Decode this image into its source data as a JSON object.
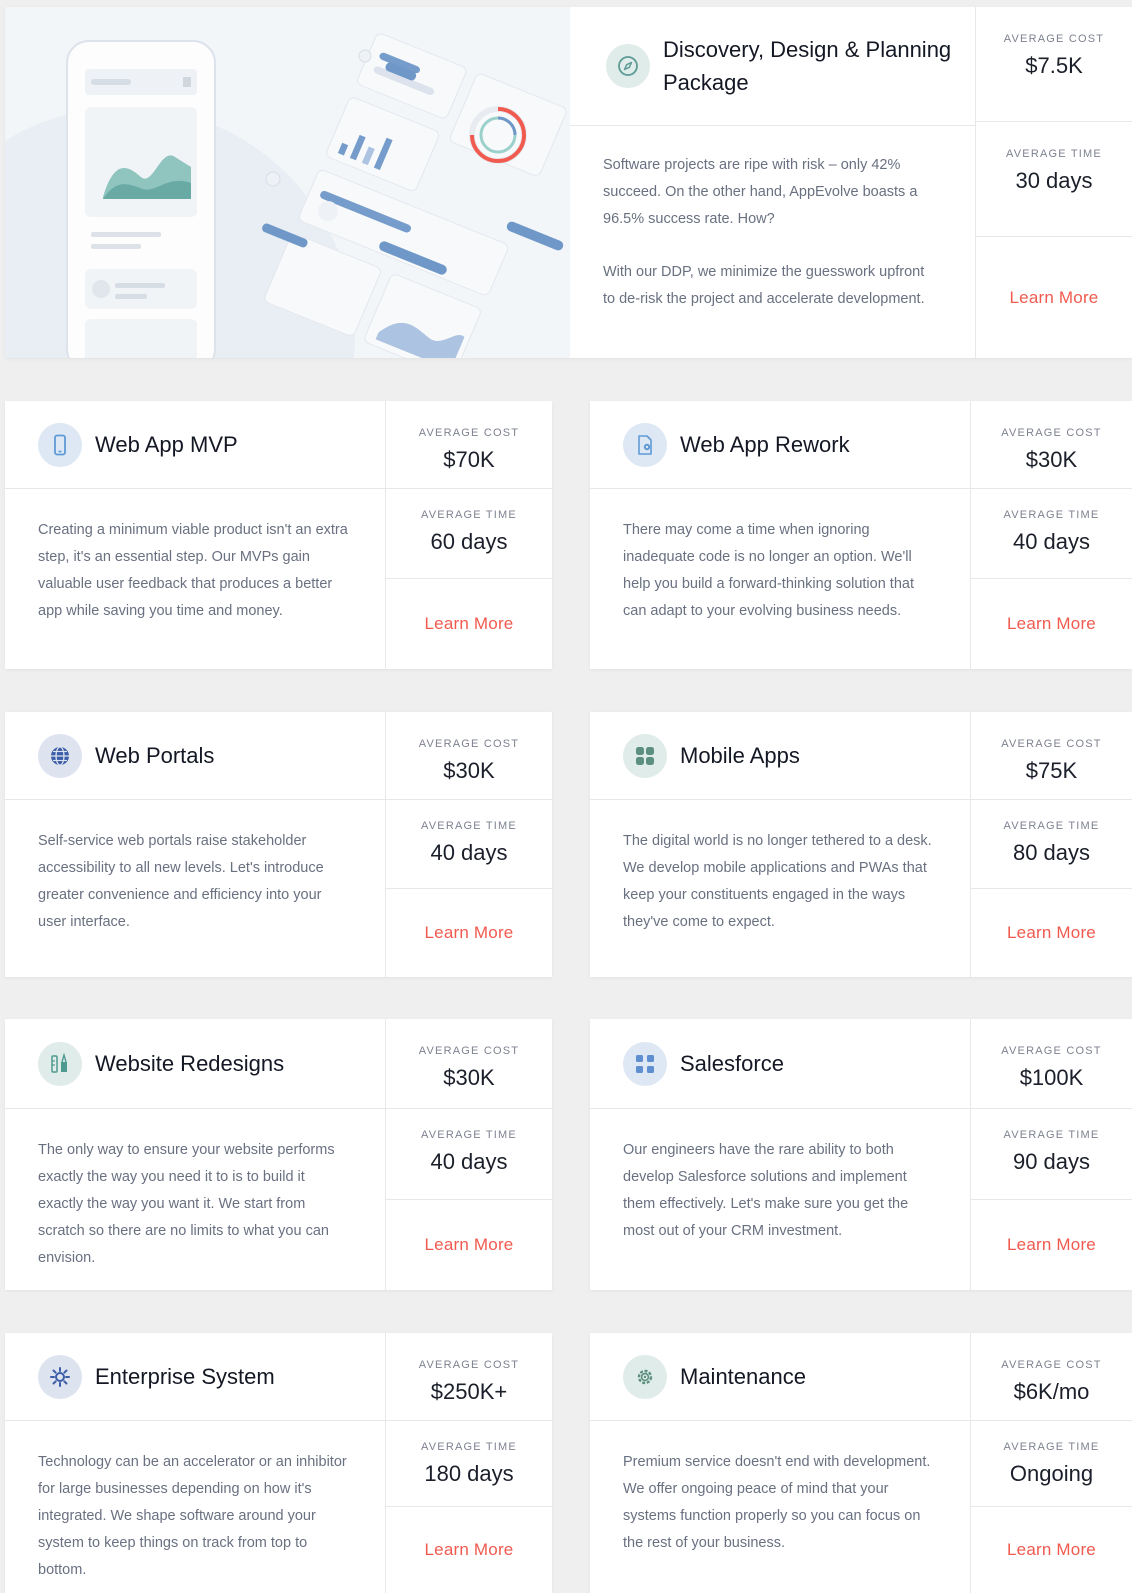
{
  "labels": {
    "cost": "AVERAGE COST",
    "time": "AVERAGE TIME",
    "cta": "Learn More"
  },
  "colors": {
    "accent": "#f05a4f",
    "teal": "#7fbcb7",
    "blue": "#6f98c8"
  },
  "hero": {
    "title": "Discovery, Design & Planning Package",
    "icon": "compass-icon",
    "paragraphs": [
      "Software projects are ripe with risk – only 42% succeed. On the other hand, AppEvolve boasts a 96.5% success rate. How?",
      "With our DDP, we minimize the guesswork upfront to de-risk the project and accelerate development."
    ],
    "cost": "$7.5K",
    "time": "30 days"
  },
  "services": [
    {
      "title": "Web App MVP",
      "icon": "mobile-phone-icon",
      "description": "Creating a minimum viable product isn't an extra step, it's an essential step. Our MVPs gain valuable user feedback that produces a better app while saving you time and money.",
      "cost": "$70K",
      "time": "60 days"
    },
    {
      "title": "Web App Rework",
      "icon": "gear-document-icon",
      "description": "There may come a time when ignoring inadequate code is no longer an option. We'll help you build a forward-thinking solution that can adapt to your evolving business needs.",
      "cost": "$30K",
      "time": "40 days"
    },
    {
      "title": "Web Portals",
      "icon": "globe-icon",
      "description": "Self-service web portals raise stakeholder accessibility to all new levels. Let's introduce greater convenience and efficiency into your user interface.",
      "cost": "$30K",
      "time": "40 days"
    },
    {
      "title": "Mobile Apps",
      "icon": "app-grid-icon",
      "description": "The digital world is no longer tethered to a desk. We develop mobile applications and PWAs that keep your constituents engaged in the ways they've come to expect.",
      "cost": "$75K",
      "time": "80 days"
    },
    {
      "title": "Website Redesigns",
      "icon": "design-tools-icon",
      "description": "The only way to ensure your website performs exactly the way you need it to is to build it exactly the way you want it. We start from scratch so there are no limits to what you can envision.",
      "cost": "$30K",
      "time": "40 days"
    },
    {
      "title": "Salesforce",
      "icon": "workflow-icon",
      "description": "Our engineers have the rare ability to both develop Salesforce solutions and implement them effectively. Let's make sure you get the most out of your CRM investment.",
      "cost": "$100K",
      "time": "90 days"
    },
    {
      "title": "Enterprise System",
      "icon": "network-gear-icon",
      "description": "Technology can be an accelerator or an inhibitor for large businesses depending on how it's integrated. We shape software around your system to keep things on track from top to bottom.",
      "cost": "$250K+",
      "time": "180 days"
    },
    {
      "title": "Maintenance",
      "icon": "maintenance-gear-icon",
      "description": "Premium service doesn't end with development. We offer ongoing peace of mind that your systems function properly so you can focus on the rest of your business.",
      "cost": "$6K/mo",
      "time": "Ongoing"
    }
  ]
}
